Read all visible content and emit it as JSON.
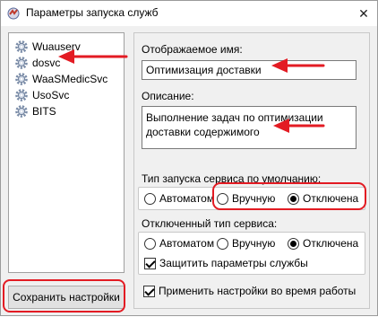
{
  "window": {
    "title": "Параметры запуска служб",
    "close_glyph": "✕"
  },
  "services": [
    {
      "name": "Wuauserv"
    },
    {
      "name": "dosvc"
    },
    {
      "name": "WaaSMedicSvc"
    },
    {
      "name": "UsoSvc"
    },
    {
      "name": "BITS"
    }
  ],
  "buttons": {
    "save_label": "Сохранить настройки"
  },
  "details": {
    "display_name_label": "Отображаемое имя:",
    "display_name_value": "Оптимизация доставки",
    "description_label": "Описание:",
    "description_line1": "Выполнение задач по оптимизации",
    "description_line2": "доставки содержимого"
  },
  "default_startup": {
    "label": "Тип запуска сервиса по умолчанию:",
    "options": [
      "Автоматом",
      "Вручную",
      "Отключена"
    ],
    "selected": "Отключена"
  },
  "disabled_type": {
    "label": "Отключенный тип сервиса:",
    "options": [
      "Автоматом",
      "Вручную",
      "Отключена"
    ],
    "selected": "Отключена",
    "protect_label": "Защитить параметры службы",
    "protect_checked": true
  },
  "apply_runtime": {
    "label": "Применить настройки во время работы",
    "checked": true
  },
  "colors": {
    "annotation_red": "#e31b23",
    "window_bg": "#f0f0f0"
  },
  "icons": {
    "app": "app-icon",
    "service": "gear-icon",
    "close": "close-icon"
  }
}
